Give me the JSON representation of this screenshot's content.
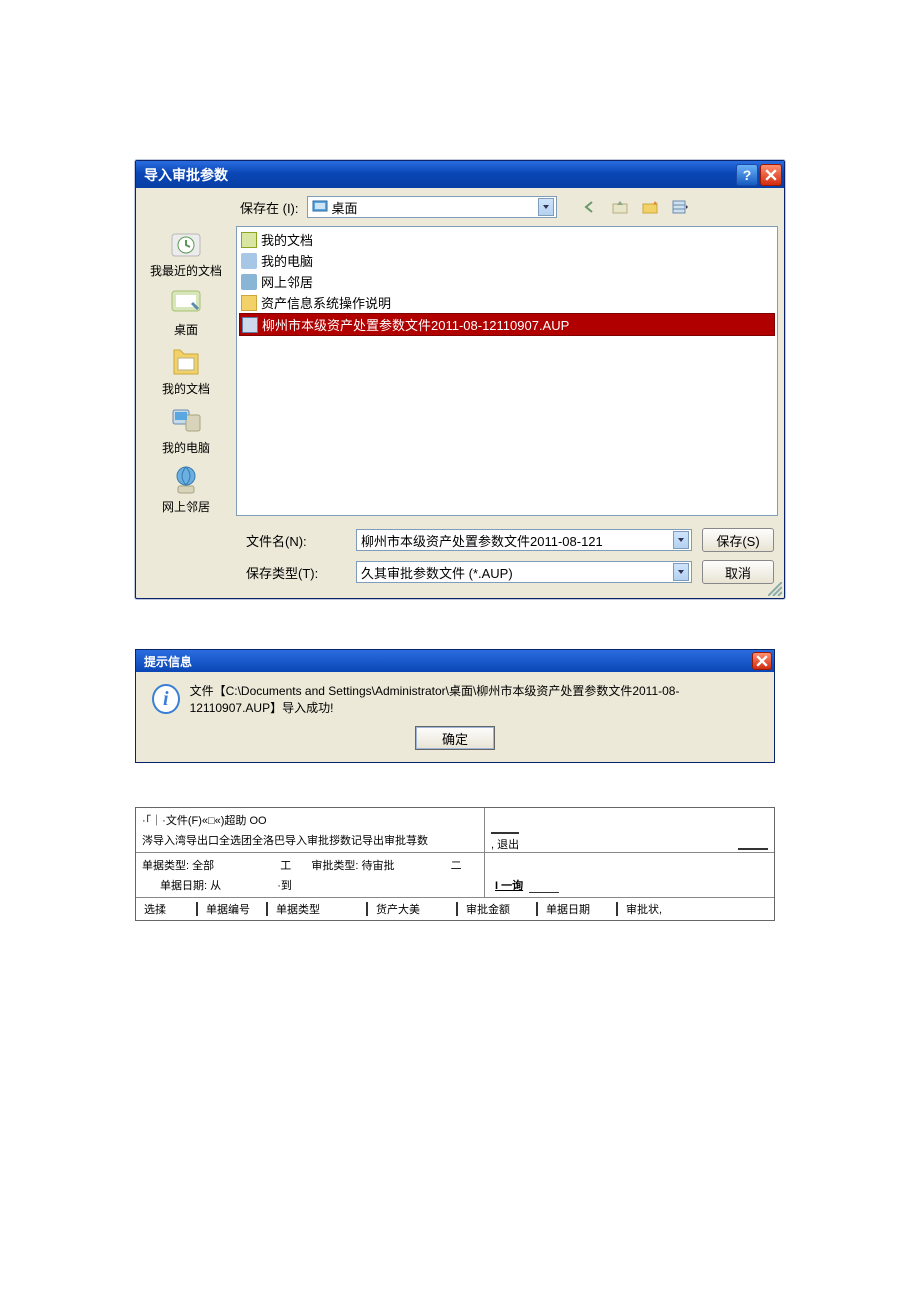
{
  "dialog1": {
    "title": "导入审批参数",
    "save_in_label": "保存在 (I):",
    "save_in_value": "桌面",
    "sidebar": [
      {
        "label": "我最近的文档"
      },
      {
        "label": "桌面"
      },
      {
        "label": "我的文档"
      },
      {
        "label": "我的电脑"
      },
      {
        "label": "网上邻居"
      }
    ],
    "files": [
      {
        "name": "我的文档",
        "icon": "doc-i"
      },
      {
        "name": "我的电脑",
        "icon": "comp-i"
      },
      {
        "name": "网上邻居",
        "icon": "net-i"
      },
      {
        "name": "资产信息系统操作说明",
        "icon": "folder-i"
      },
      {
        "name": "柳州市本级资产处置参数文件2011-08-12110907.AUP",
        "icon": "file-i",
        "selected": true
      }
    ],
    "filename_label": "文件名(N):",
    "filename_value": "柳州市本级资产处置参数文件2011-08-121",
    "filetype_label": "保存类型(T):",
    "filetype_value": "久其审批参数文件 (*.AUP)",
    "save_btn": "保存(S)",
    "cancel_btn": "取消"
  },
  "msgbox": {
    "title": "提示信息",
    "body": "文件【C:\\Documents and Settings\\Administrator\\桌面\\柳州市本级资产处置参数文件2011-08-12110907.AUP】导入成功!",
    "ok": "确定"
  },
  "grid": {
    "menu": "·｢｜·文件(F)«□«)超助 OO",
    "toolbar": "涔导入湾导出口全选团全洛巴导入审批拶数记导出审批荨数",
    "exit": ", 退出",
    "filter_line1_a": "单据类型: 全部",
    "filter_line1_b": "工",
    "filter_line1_c": "审批类型: 待宙批",
    "filter_line1_d": "二",
    "filter_line2_a": "单据日期: 从",
    "filter_line2_b": "·到",
    "query_btn": "I 一询",
    "headers": [
      "选揉",
      "单据编号",
      "单据类型",
      "货产大美",
      "审批金额",
      "单据日期",
      "审批状,"
    ]
  }
}
